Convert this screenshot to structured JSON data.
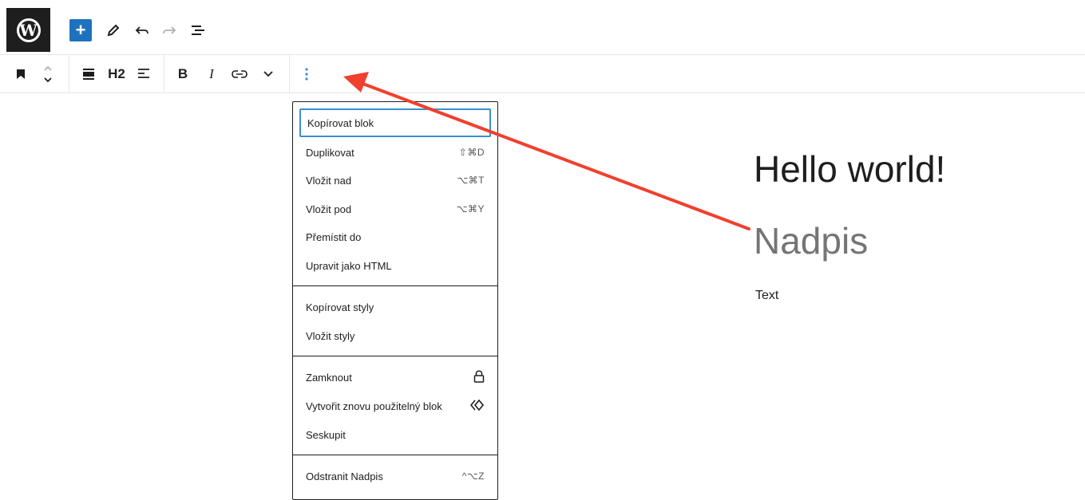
{
  "topbar": {
    "add_label": "+",
    "icons": [
      "wordpress-logo-icon",
      "plus-icon",
      "pencil-icon",
      "undo-icon",
      "redo-icon",
      "list-view-icon"
    ]
  },
  "block_toolbar": {
    "heading_level": "H2",
    "bold": "B",
    "italic": "I",
    "icons": [
      "bookmark-icon",
      "move-up-down-icon",
      "align-icon",
      "text-align-icon",
      "link-icon",
      "chevron-down-icon",
      "more-options-icon"
    ]
  },
  "menu": {
    "sections": [
      {
        "items": [
          {
            "label": "Kopírovat blok",
            "shortcut": ""
          },
          {
            "label": "Duplikovat",
            "shortcut": "⇧⌘D"
          },
          {
            "label": "Vložit nad",
            "shortcut": "⌥⌘T"
          },
          {
            "label": "Vložit pod",
            "shortcut": "⌥⌘Y"
          },
          {
            "label": "Přemístit do",
            "shortcut": ""
          },
          {
            "label": "Upravit jako HTML",
            "shortcut": ""
          }
        ]
      },
      {
        "items": [
          {
            "label": "Kopírovat styly",
            "shortcut": ""
          },
          {
            "label": "Vložit styly",
            "shortcut": ""
          }
        ]
      },
      {
        "items": [
          {
            "label": "Zamknout",
            "icon": "lock-icon"
          },
          {
            "label": "Vytvořit znovu použitelný blok",
            "icon": "reusable-block-icon"
          },
          {
            "label": "Seskupit",
            "shortcut": ""
          }
        ]
      },
      {
        "items": [
          {
            "label": "Odstranit Nadpis",
            "shortcut": "^⌥Z"
          }
        ]
      }
    ]
  },
  "content": {
    "title": "Hello world!",
    "heading": "Nadpis",
    "paragraph": "Text"
  },
  "colors": {
    "accent": "#1e72bd",
    "focus": "#3a8fd1",
    "annotation_arrow": "#f0402e",
    "heading_gray": "#757575"
  }
}
